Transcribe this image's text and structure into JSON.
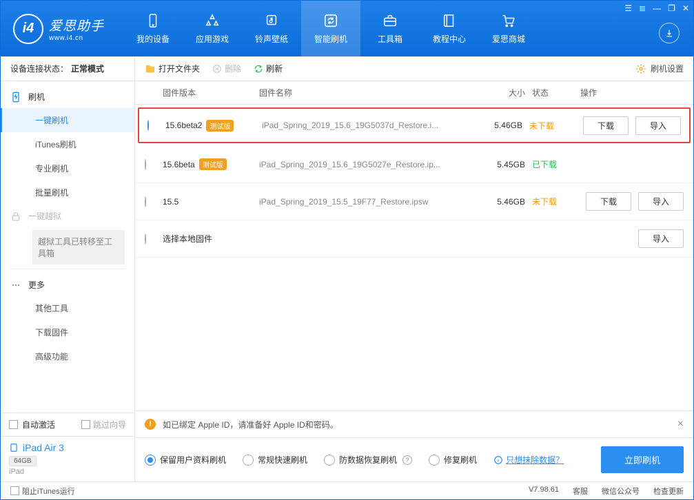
{
  "brand": {
    "cn": "爱思助手",
    "url": "www.i4.cn"
  },
  "window_controls": [
    "☰",
    "≣",
    "—",
    "❐",
    "✕"
  ],
  "topnav": [
    {
      "label": "我的设备"
    },
    {
      "label": "应用游戏"
    },
    {
      "label": "铃声壁纸"
    },
    {
      "label": "智能刷机"
    },
    {
      "label": "工具箱"
    },
    {
      "label": "教程中心"
    },
    {
      "label": "爱思商城"
    }
  ],
  "device_status": {
    "prefix": "设备连接状态：",
    "mode": "正常模式"
  },
  "sidebar": {
    "flash": {
      "title": "刷机",
      "items": [
        "一键刷机",
        "iTunes刷机",
        "专业刷机",
        "批量刷机"
      ]
    },
    "jailbreak": {
      "title": "一键越狱",
      "note": "越狱工具已转移至工具箱"
    },
    "more": {
      "title": "更多",
      "items": [
        "其他工具",
        "下载固件",
        "高级功能"
      ]
    },
    "auto_activate": "自动激活",
    "skip_guide": "跳过向导",
    "device": {
      "name": "iPad Air 3",
      "storage": "64GB",
      "type": "iPad"
    }
  },
  "toolbar": {
    "open": "打开文件夹",
    "delete": "删除",
    "refresh": "刷新",
    "settings": "刷机设置"
  },
  "table": {
    "headers": {
      "version": "固件版本",
      "name": "固件名称",
      "size": "大小",
      "status": "状态",
      "actions": "操作"
    },
    "rows": [
      {
        "version": "15.6beta2",
        "beta": "测试版",
        "name": "iPad_Spring_2019_15.6_19G5037d_Restore.i...",
        "size": "5.46GB",
        "status": "未下载",
        "status_key": "nd",
        "selected": true,
        "highlight": true,
        "download": "下载",
        "import": "导入"
      },
      {
        "version": "15.6beta",
        "beta": "测试版",
        "name": "iPad_Spring_2019_15.6_19G5027e_Restore.ip...",
        "size": "5.45GB",
        "status": "已下载",
        "status_key": "dl",
        "selected": false
      },
      {
        "version": "15.5",
        "name": "iPad_Spring_2019_15.5_19F77_Restore.ipsw",
        "size": "5.46GB",
        "status": "未下载",
        "status_key": "nd",
        "selected": false,
        "download": "下载",
        "import": "导入"
      },
      {
        "local": true,
        "label": "选择本地固件",
        "import": "导入"
      }
    ]
  },
  "alert": "如已绑定 Apple ID，请准备好 Apple ID和密码。",
  "options": {
    "items": [
      "保留用户资料刷机",
      "常规快速刷机",
      "防数据恢复刷机",
      "修复刷机"
    ],
    "wipe": "只想抹除数据？",
    "go": "立即刷机"
  },
  "statusbar": {
    "block_itunes": "阻止iTunes运行",
    "version": "V7.98.61",
    "links": [
      "客服",
      "微信公众号",
      "检查更新"
    ]
  }
}
